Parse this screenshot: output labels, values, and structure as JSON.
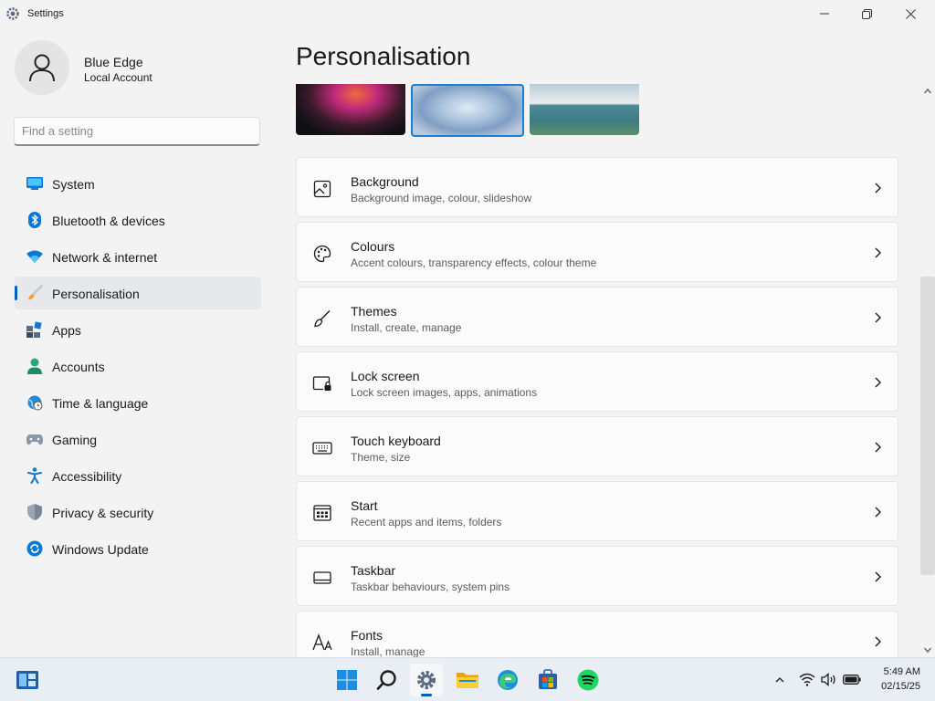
{
  "window": {
    "title": "Settings"
  },
  "profile": {
    "name": "Blue Edge",
    "account_type": "Local Account"
  },
  "search": {
    "placeholder": "Find a setting",
    "value": ""
  },
  "sidebar": {
    "items": [
      {
        "label": "System",
        "icon": "system-icon",
        "active": false
      },
      {
        "label": "Bluetooth & devices",
        "icon": "bluetooth-icon",
        "active": false
      },
      {
        "label": "Network & internet",
        "icon": "wifi-icon",
        "active": false
      },
      {
        "label": "Personalisation",
        "icon": "brush-icon",
        "active": true
      },
      {
        "label": "Apps",
        "icon": "apps-icon",
        "active": false
      },
      {
        "label": "Accounts",
        "icon": "person-icon",
        "active": false
      },
      {
        "label": "Time & language",
        "icon": "globe-clock-icon",
        "active": false
      },
      {
        "label": "Gaming",
        "icon": "gamepad-icon",
        "active": false
      },
      {
        "label": "Accessibility",
        "icon": "accessibility-icon",
        "active": false
      },
      {
        "label": "Privacy & security",
        "icon": "shield-icon",
        "active": false
      },
      {
        "label": "Windows Update",
        "icon": "update-icon",
        "active": false
      }
    ]
  },
  "main": {
    "title": "Personalisation",
    "cards": [
      {
        "title": "Background",
        "subtitle": "Background image, colour, slideshow",
        "icon": "image-icon"
      },
      {
        "title": "Colours",
        "subtitle": "Accent colours, transparency effects, colour theme",
        "icon": "palette-icon"
      },
      {
        "title": "Themes",
        "subtitle": "Install, create, manage",
        "icon": "brush-icon"
      },
      {
        "title": "Lock screen",
        "subtitle": "Lock screen images, apps, animations",
        "icon": "lock-screen-icon"
      },
      {
        "title": "Touch keyboard",
        "subtitle": "Theme, size",
        "icon": "keyboard-icon"
      },
      {
        "title": "Start",
        "subtitle": "Recent apps and items, folders",
        "icon": "start-icon"
      },
      {
        "title": "Taskbar",
        "subtitle": "Taskbar behaviours, system pins",
        "icon": "taskbar-icon"
      },
      {
        "title": "Fonts",
        "subtitle": "Install, manage",
        "icon": "fonts-icon"
      }
    ]
  },
  "taskbar": {
    "apps": [
      "widgets-icon",
      "start-icon",
      "search-icon",
      "settings-icon",
      "file-explorer-icon",
      "edge-icon",
      "store-icon",
      "spotify-icon"
    ],
    "clock": {
      "time": "5:49 AM",
      "date": "02/15/25"
    }
  },
  "colors": {
    "accent": "#005fb8",
    "background": "#f3f3f3",
    "card": "#fbfbfb"
  }
}
